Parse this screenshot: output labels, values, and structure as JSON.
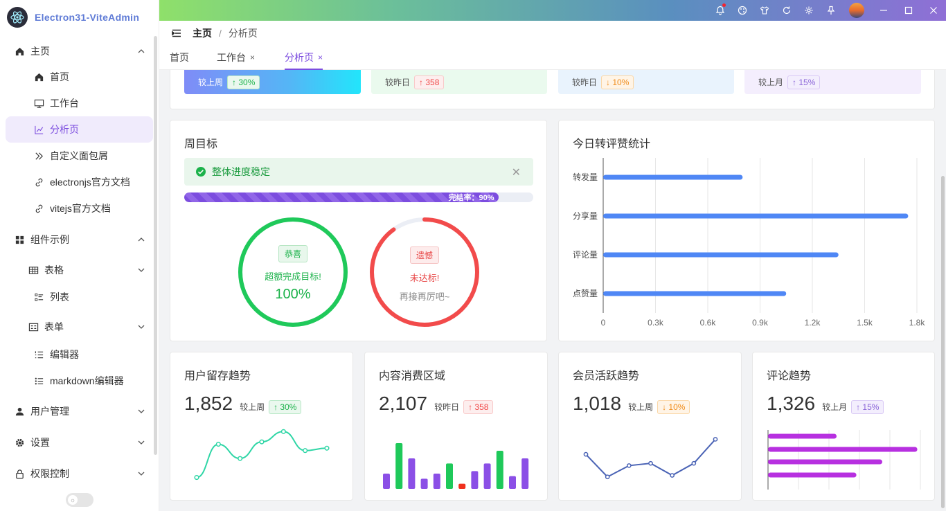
{
  "app": {
    "title": "Electron31-ViteAdmin"
  },
  "sidebar": {
    "items": [
      {
        "label": "主页",
        "level": 1,
        "icon": "home-icon",
        "expanded": true
      },
      {
        "label": "首页",
        "level": 2,
        "icon": "home-icon"
      },
      {
        "label": "工作台",
        "level": 2,
        "icon": "monitor-icon"
      },
      {
        "label": "分析页",
        "level": 2,
        "icon": "chart-line-icon",
        "active": true
      },
      {
        "label": "自定义面包屑",
        "level": 2,
        "icon": "double-chevron-icon"
      },
      {
        "label": "electronjs官方文档",
        "level": 2,
        "icon": "link-icon"
      },
      {
        "label": "vitejs官方文档",
        "level": 2,
        "icon": "link-icon"
      },
      {
        "label": "组件示例",
        "level": 1,
        "icon": "grid-icon",
        "expanded": true
      },
      {
        "label": "表格",
        "level": 2,
        "icon": "table-icon",
        "expandable": true
      },
      {
        "label": "列表",
        "level": 3,
        "icon": "list-icon"
      },
      {
        "label": "表单",
        "level": 2,
        "icon": "form-icon",
        "expandable": true
      },
      {
        "label": "编辑器",
        "level": 3,
        "icon": "ordered-list-icon"
      },
      {
        "label": "markdown编辑器",
        "level": 3,
        "icon": "bullet-list-icon"
      },
      {
        "label": "用户管理",
        "level": 1,
        "icon": "user-icon"
      },
      {
        "label": "设置",
        "level": 1,
        "icon": "gear-icon"
      },
      {
        "label": "权限控制",
        "level": 1,
        "icon": "lock-icon"
      }
    ]
  },
  "breadcrumb": {
    "root": "主页",
    "sep": "/",
    "current": "分析页"
  },
  "tabs": [
    {
      "label": "首页",
      "closable": false
    },
    {
      "label": "工作台",
      "closable": true
    },
    {
      "label": "分析页",
      "closable": true,
      "active": true
    }
  ],
  "tab_close": "×",
  "top_stats": [
    {
      "cmp": "较上周",
      "delta": "↑ 30%",
      "style": "green"
    },
    {
      "cmp": "较昨日",
      "delta": "↑ 358",
      "style": "red"
    },
    {
      "cmp": "较昨日",
      "delta": "↓ 10%",
      "style": "orange"
    },
    {
      "cmp": "较上月",
      "delta": "↑ 15%",
      "style": "purple"
    }
  ],
  "weekly": {
    "title": "周目标",
    "alert": "整体进度稳定",
    "progress_label": "完结率：90%",
    "progress": 0.9,
    "left_ring": {
      "tag": "恭喜",
      "line1": "超额完成目标!",
      "line2": "100%",
      "fraction": 1.0
    },
    "right_ring": {
      "tag": "遗憾",
      "line1": "未达标!",
      "line2": "再接再厉吧~",
      "fraction": 0.9
    }
  },
  "colors": {
    "accent": "#7c4ddf",
    "green": "#1fc95a",
    "red": "#f24b4b",
    "blue": "#4f87f5"
  },
  "chart_data": [
    {
      "type": "bar",
      "orientation": "horizontal",
      "title": "今日转评赞统计",
      "categories": [
        "转发量",
        "分享量",
        "评论量",
        "点赞量"
      ],
      "values": [
        800,
        1750,
        1350,
        1050
      ],
      "xlim": [
        0,
        1800
      ],
      "xticks": [
        "0",
        "0.3k",
        "0.6k",
        "0.9k",
        "1.2k",
        "1.5k",
        "1.8k"
      ],
      "grid": true
    },
    {
      "type": "line",
      "title": "用户留存趋势",
      "value": "1,852",
      "cmp": "较上周",
      "delta": "↑ 30%",
      "values": [
        10,
        52,
        34,
        55,
        68,
        44,
        47
      ],
      "smooth": true
    },
    {
      "type": "bar",
      "title": "内容消费区域",
      "value": "2,107",
      "cmp": "较昨日",
      "delta": "↑ 358",
      "values": [
        6,
        18,
        12,
        4,
        6,
        10,
        2,
        7,
        10,
        15,
        5,
        12
      ]
    },
    {
      "type": "line",
      "title": "会员活跃趋势",
      "value": "1,018",
      "cmp": "较上周",
      "delta": "↓ 10%",
      "values": [
        45,
        15,
        30,
        33,
        17,
        33,
        65
      ]
    },
    {
      "type": "bar",
      "orientation": "horizontal",
      "title": "评论趋势",
      "value": "1,326",
      "cmp": "较上月",
      "delta": "↑ 15%",
      "values": [
        45,
        98,
        75,
        58
      ],
      "xlim": [
        0,
        100
      ]
    }
  ]
}
